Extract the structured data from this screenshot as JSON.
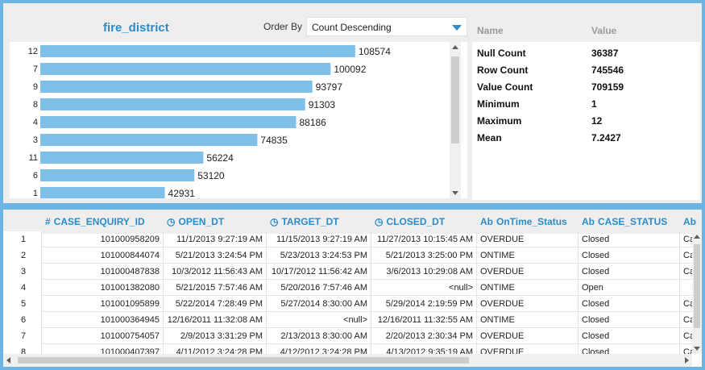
{
  "chart_panel": {
    "title": "fire_district",
    "order_by_label": "Order By",
    "order_by_value": "Count Descending"
  },
  "chart_data": {
    "type": "bar",
    "orientation": "horizontal",
    "categories": [
      "12",
      "7",
      "9",
      "8",
      "4",
      "3",
      "11",
      "6",
      "1"
    ],
    "values": [
      108574,
      100092,
      93797,
      91303,
      88186,
      74835,
      56224,
      53120,
      42931
    ],
    "color": "#7fbfe8"
  },
  "stats": {
    "header_name": "Name",
    "header_value": "Value",
    "rows": [
      {
        "name": "Null Count",
        "value": "36387"
      },
      {
        "name": "Row Count",
        "value": "745546"
      },
      {
        "name": "Value Count",
        "value": "709159"
      },
      {
        "name": "Minimum",
        "value": "1"
      },
      {
        "name": "Maximum",
        "value": "12"
      },
      {
        "name": "Mean",
        "value": "7.2427"
      }
    ]
  },
  "grid": {
    "columns": [
      {
        "icon": "#",
        "icon_name": "numeric-icon",
        "label": "CASE_ENQUIRY_ID"
      },
      {
        "icon": "◷",
        "icon_name": "datetime-icon",
        "label": "OPEN_DT"
      },
      {
        "icon": "◷",
        "icon_name": "datetime-icon",
        "label": "TARGET_DT"
      },
      {
        "icon": "◷",
        "icon_name": "datetime-icon",
        "label": "CLOSED_DT"
      },
      {
        "icon": "Ab",
        "icon_name": "text-icon",
        "label": "OnTime_Status"
      },
      {
        "icon": "Ab",
        "icon_name": "text-icon",
        "label": "CASE_STATUS"
      },
      {
        "icon": "Ab",
        "icon_name": "text-icon",
        "label": ""
      }
    ],
    "rows": [
      {
        "num": "1",
        "cells": [
          "101000958209",
          "11/1/2013 9:27:19 AM",
          "11/15/2013 9:27:19 AM",
          "11/27/2013 10:15:45 AM",
          "OVERDUE",
          "Closed",
          "Ca"
        ]
      },
      {
        "num": "2",
        "cells": [
          "101000844074",
          "5/21/2013 3:24:54 PM",
          "5/23/2013 3:24:53 PM",
          "5/21/2013 3:25:00 PM",
          "ONTIME",
          "Closed",
          "Ca"
        ]
      },
      {
        "num": "3",
        "cells": [
          "101000487838",
          "10/3/2012 11:56:43 AM",
          "10/17/2012 11:56:42 AM",
          "3/6/2013 10:29:08 AM",
          "OVERDUE",
          "Closed",
          "Ca"
        ]
      },
      {
        "num": "4",
        "cells": [
          "101001382080",
          "5/21/2015 7:57:46 AM",
          "5/20/2016 7:57:46 AM",
          "<null>",
          "ONTIME",
          "Open",
          ""
        ]
      },
      {
        "num": "5",
        "cells": [
          "101001095899",
          "5/22/2014 7:28:49 PM",
          "5/27/2014 8:30:00 AM",
          "5/29/2014 2:19:59 PM",
          "OVERDUE",
          "Closed",
          "Ca"
        ]
      },
      {
        "num": "6",
        "cells": [
          "101000364945",
          "12/16/2011 11:32:08 AM",
          "<null>",
          "12/16/2011 11:32:55 AM",
          "ONTIME",
          "Closed",
          "Ca"
        ]
      },
      {
        "num": "7",
        "cells": [
          "101000754057",
          "2/9/2013 3:31:29 PM",
          "2/13/2013 8:30:00 AM",
          "2/20/2013 2:30:34 PM",
          "OVERDUE",
          "Closed",
          "Ca"
        ]
      },
      {
        "num": "8",
        "cells": [
          "101000407397",
          "4/11/2012 3:24:28 PM",
          "4/12/2012 3:24:28 PM",
          "4/13/2012 9:35:19 AM",
          "OVERDUE",
          "Closed",
          "Ca"
        ]
      }
    ]
  }
}
